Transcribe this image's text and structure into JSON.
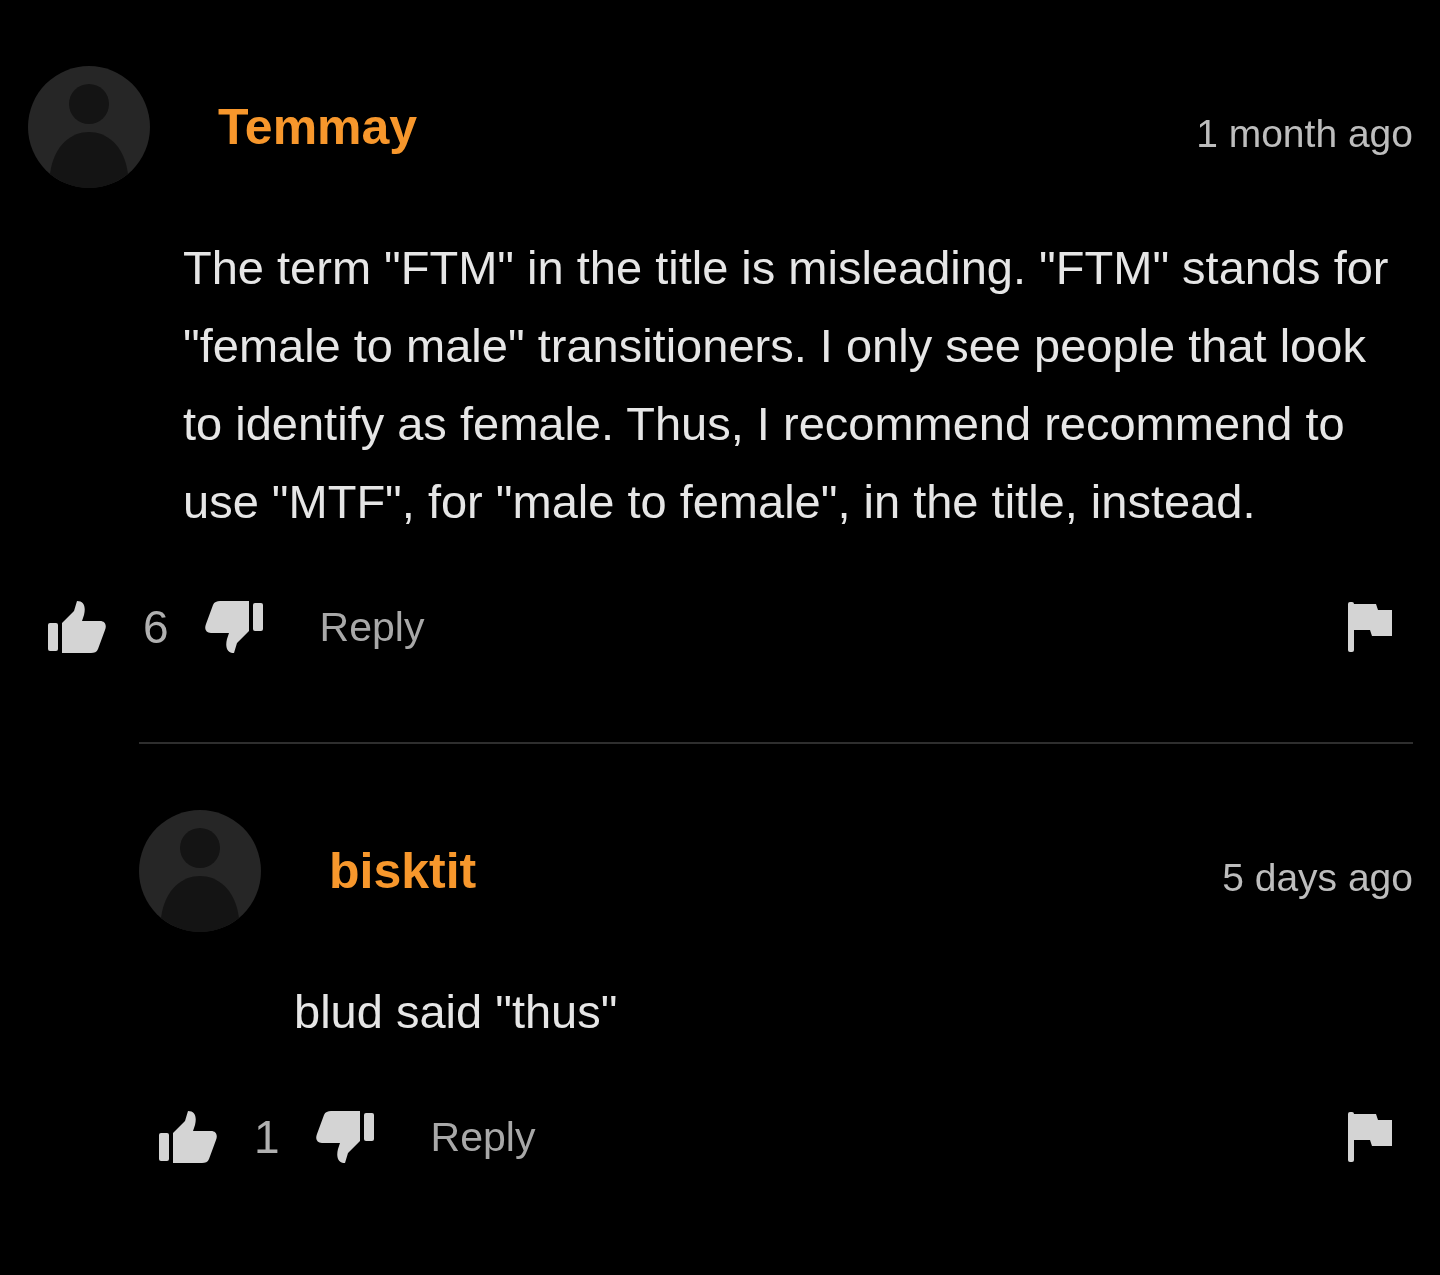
{
  "comments": [
    {
      "author": "Temmay",
      "time": "1 month ago",
      "text": "The term \"FTM\" in the title is misleading. \"FTM\" stands for \"female to male\" transitioners. I only see people that look to identify as female. Thus, I recommend recommend to use \"MTF\", for \"male to female\", in the title, instead.",
      "likes": "6",
      "reply_label": "Reply",
      "children": [
        {
          "author": "bisktit",
          "time": "5 days ago",
          "text": "blud said \"thus\"",
          "likes": "1",
          "reply_label": "Reply"
        }
      ]
    }
  ]
}
